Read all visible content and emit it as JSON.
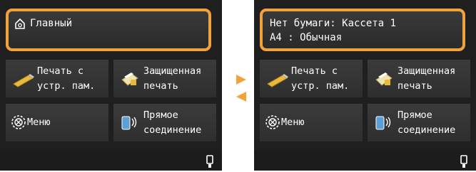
{
  "left_screen": {
    "home_label": "Главный",
    "tiles": {
      "print_from_memory": [
        "Печать с",
        "устр. пам."
      ],
      "secure_print": [
        "Защищенная",
        "печать"
      ],
      "menu": "Меню",
      "direct_connection": [
        "Прямое",
        "соединение"
      ]
    }
  },
  "right_screen": {
    "status_line1": "Нет бумаги: Кассета 1",
    "status_line2": "A4 : Обычная",
    "tiles": {
      "print_from_memory": [
        "Печать с",
        "устр. пам."
      ],
      "secure_print": [
        "Защищенная",
        "печать"
      ],
      "menu": "Меню",
      "direct_connection": [
        "Прямое",
        "соединение"
      ]
    }
  },
  "colors": {
    "accent_orange": "#f2a23a",
    "screen_bg": "#1f1f1f",
    "tile_bg": "#343434"
  },
  "icons": [
    "home-icon",
    "usb-stick-icon",
    "secure-print-icon",
    "menu-gear-icon",
    "direct-connection-icon",
    "usb-port-icon",
    "arrow-right-icon",
    "arrow-left-icon"
  ]
}
